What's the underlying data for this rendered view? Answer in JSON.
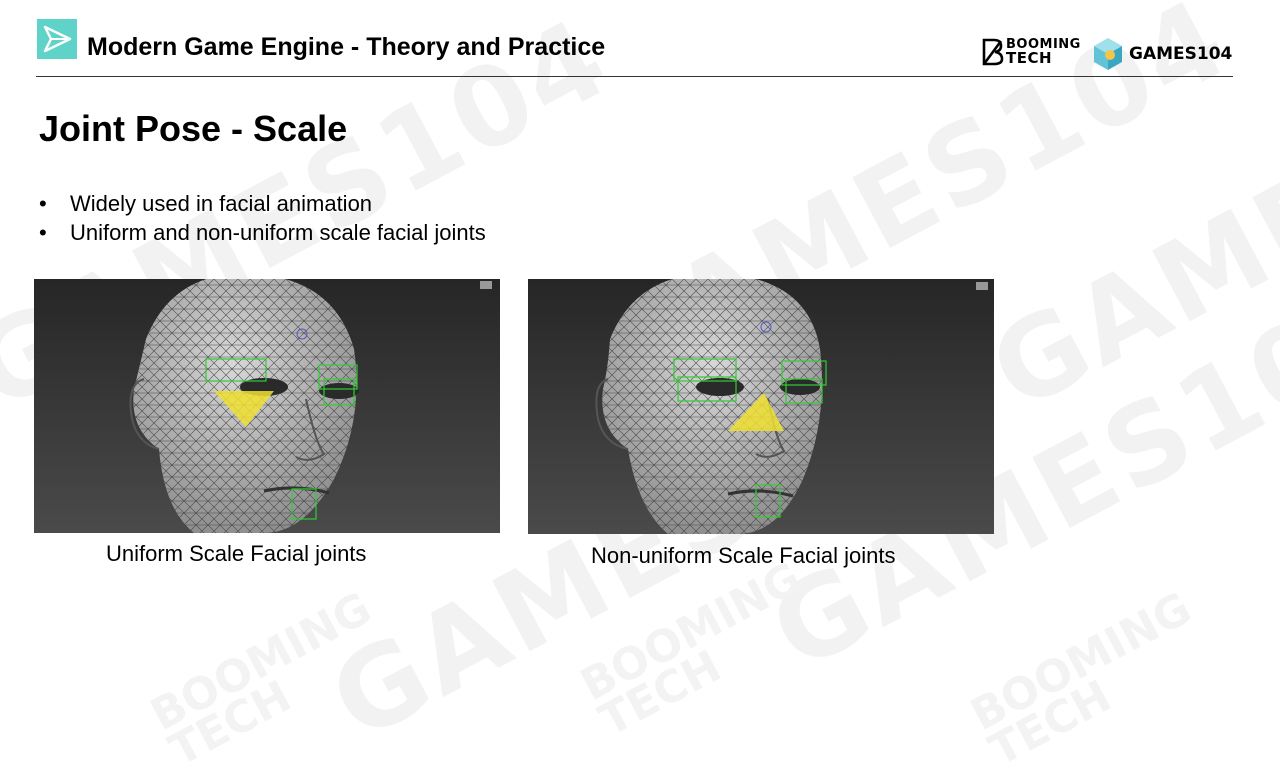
{
  "header": {
    "course_title": "Modern Game Engine - Theory and Practice",
    "brand_booming_line1": "BOOMING",
    "brand_booming_line2": "TECH",
    "brand_games": "GAMES104"
  },
  "slide": {
    "title": "Joint Pose - Scale",
    "bullets": [
      "Widely used in facial animation",
      "Uniform and non-uniform scale facial joints"
    ],
    "figures": [
      {
        "caption": "Uniform Scale Facial joints",
        "icon": "wireframe-face-image",
        "highlight": "inverted-yellow-triangle"
      },
      {
        "caption": "Non-uniform Scale Facial joints",
        "icon": "wireframe-face-image",
        "highlight": "upright-yellow-triangle"
      }
    ]
  },
  "watermark": {
    "text_games": "GAMES104",
    "text_booming": "BOOMING",
    "text_tech": "TECH"
  },
  "colors": {
    "accent_teal": "#5fd3c8",
    "viewport_bg": "#3a3a3a",
    "joint_green": "#33cc33",
    "highlight_yellow": "#f0e030"
  }
}
